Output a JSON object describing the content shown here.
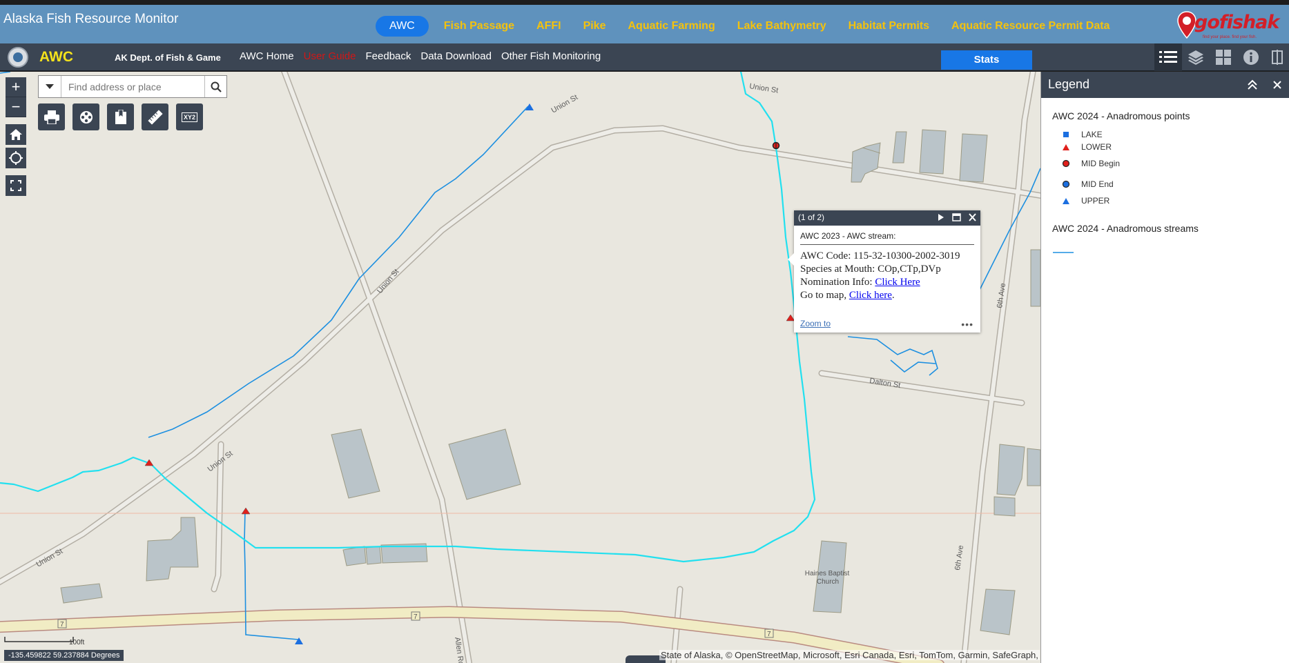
{
  "app": {
    "title": "Alaska Fish Resource Monitor"
  },
  "tabs": [
    {
      "label": "AWC",
      "active": true
    },
    {
      "label": "Fish Passage"
    },
    {
      "label": "AFFI"
    },
    {
      "label": "Pike"
    },
    {
      "label": "Aquatic Farming"
    },
    {
      "label": "Lake Bathymetry"
    },
    {
      "label": "Habitat Permits"
    },
    {
      "label": "Aquatic Resource Permit Data"
    }
  ],
  "logo": {
    "text": "gofishak",
    "tagline": "find your place. find your fish."
  },
  "nav": {
    "awc_label": "AWC",
    "dept_label": "AK Dept. of Fish & Game",
    "links": [
      "AWC Home",
      "User Guide",
      "Feedback",
      "Data Download",
      "Other Fish Monitoring"
    ],
    "stats_label": "Stats"
  },
  "toolbar_icons": [
    "list-icon",
    "layers-icon",
    "basemap-grid-icon",
    "info-icon",
    "swipe-icon"
  ],
  "map_controls": {
    "zoom_in": "+",
    "zoom_out": "−",
    "search_placeholder": "Find address or place",
    "tools": [
      "print-icon",
      "film-reel-icon",
      "bookmark-icon",
      "measure-icon",
      "XY2"
    ]
  },
  "map_labels": {
    "streets": [
      "Union St",
      "Union St",
      "Union St",
      "Union St",
      "Union St",
      "6th Ave",
      "6th Ave",
      "Dalton St",
      "Allen Rd"
    ],
    "poi": [
      "Haines Baptist",
      "Church"
    ],
    "route_shields": [
      "7",
      "7",
      "7"
    ]
  },
  "popup": {
    "counter": "(1 of 2)",
    "title": "AWC 2023 - AWC stream:",
    "awc_code_label": "AWC Code: ",
    "awc_code": "115-32-10300-2002-3019",
    "species_label": "Species at Mouth: ",
    "species": "COp,CTp,DVp",
    "nomination_label": "Nomination Info: ",
    "nomination_link": "Click Here",
    "goto_label": "Go to map, ",
    "goto_link": "Click here",
    "goto_suffix": ".",
    "zoom_to": "Zoom to",
    "more": "•••"
  },
  "legend": {
    "title": "Legend",
    "layers": [
      {
        "name": "AWC 2024 - Anadromous points",
        "items": [
          {
            "label": "LAKE",
            "symbol": "square",
            "color": "#1c6fe0"
          },
          {
            "label": "LOWER",
            "symbol": "triangle",
            "color": "#e0201c"
          },
          {
            "label": "MID Begin",
            "symbol": "circle",
            "color": "#e0201c"
          },
          {
            "label": "MID End",
            "symbol": "circle",
            "color": "#1c6fe0"
          },
          {
            "label": "UPPER",
            "symbol": "triangle",
            "color": "#1c6fe0"
          }
        ]
      },
      {
        "name": "AWC 2024 - Anadromous streams",
        "items": [
          {
            "label": "",
            "symbol": "line",
            "color": "#1c8fe0"
          }
        ]
      }
    ]
  },
  "scale": {
    "label": "100ft"
  },
  "coords": {
    "text": "-135.459822 59.237884 Degrees"
  },
  "attribution": "State of Alaska, © OpenStreetMap, Microsoft, Esri Canada, Esri, TomTom, Garmin, SafeGraph,",
  "colors": {
    "topbar": "#5f92bd",
    "navbar": "#3b4553",
    "accent": "#1877e6",
    "tab_text": "#f4c20d",
    "stream_cyan": "#22e0ef",
    "stream_blue": "#1c8fe0"
  }
}
